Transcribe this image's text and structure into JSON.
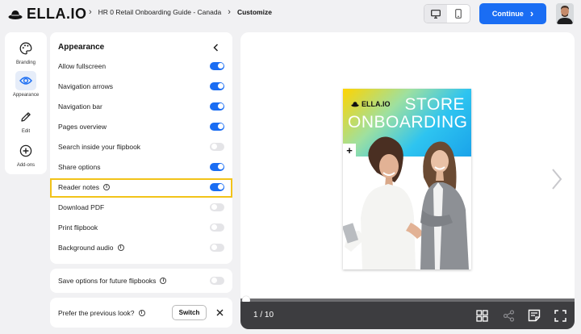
{
  "header": {
    "logo_text": "ELLA.IO",
    "breadcrumb": [
      "HR 0 Retail Onboarding Guide - Canada",
      "Customize"
    ],
    "continue_label": "Continue"
  },
  "rail": {
    "items": [
      {
        "label": "Branding",
        "icon": "palette-icon"
      },
      {
        "label": "Appearance",
        "icon": "eye-icon",
        "active": true
      },
      {
        "label": "Edit",
        "icon": "pencil-icon"
      },
      {
        "label": "Add-ons",
        "icon": "plus-circle-icon"
      }
    ]
  },
  "panel": {
    "title": "Appearance",
    "options": [
      {
        "label": "Allow fullscreen",
        "on": true
      },
      {
        "label": "Navigation arrows",
        "on": true
      },
      {
        "label": "Navigation bar",
        "on": true
      },
      {
        "label": "Pages overview",
        "on": true
      },
      {
        "label": "Search inside your flipbook",
        "on": false
      },
      {
        "label": "Share options",
        "on": true
      },
      {
        "label": "Reader notes",
        "on": true,
        "info": true,
        "highlighted": true
      },
      {
        "label": "Download PDF",
        "on": false
      },
      {
        "label": "Print flipbook",
        "on": false
      },
      {
        "label": "Background audio",
        "on": false,
        "info": true
      }
    ]
  },
  "save_options": {
    "label": "Save options for future flipbooks",
    "on": false
  },
  "prefer": {
    "label": "Prefer the previous look?",
    "switch_label": "Switch"
  },
  "preview": {
    "cover": {
      "logo": "ELLA.IO",
      "line1": "STORE",
      "line2": "ONBOARDING"
    },
    "page_indicator": "1 / 10",
    "progress": 0
  },
  "colors": {
    "accent": "#1a6df3",
    "highlight": "#f2c319",
    "bar": "#3d3d40"
  }
}
